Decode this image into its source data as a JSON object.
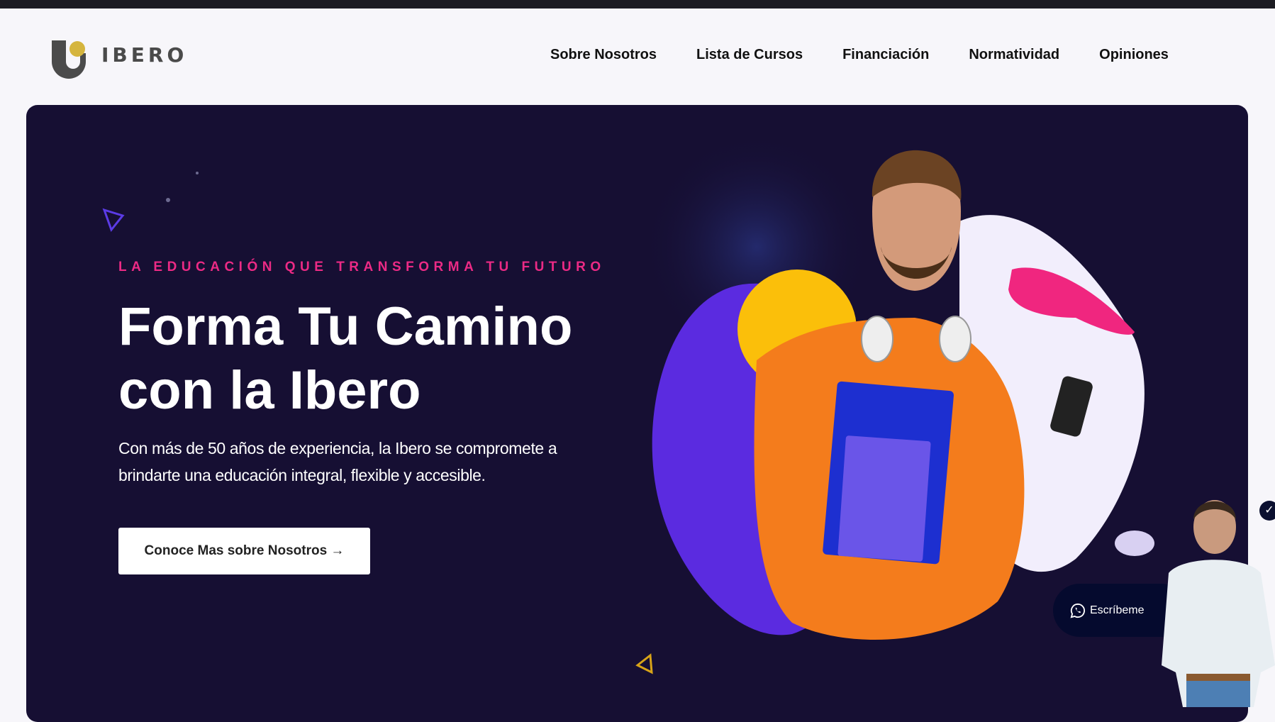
{
  "brand": {
    "name": "IBERO"
  },
  "nav": {
    "items": [
      {
        "label": "Sobre Nosotros"
      },
      {
        "label": "Lista de Cursos"
      },
      {
        "label": "Financiación"
      },
      {
        "label": "Normatividad"
      },
      {
        "label": "Opiniones"
      }
    ]
  },
  "hero": {
    "tagline": "LA EDUCACIÓN QUE TRANSFORMA TU FUTURO",
    "title_line1": "Forma Tu Camino",
    "title_line2": "con la Ibero",
    "description": "Con más de 50 años de experiencia, la Ibero se compromete a brindarte una educación integral, flexible y accesible.",
    "cta_label": "Conoce Mas sobre Nosotros →"
  },
  "chat": {
    "label": "Escríbeme",
    "icon": "whatsapp-icon"
  },
  "colors": {
    "hero_bg": "#160f33",
    "accent_pink": "#ec2a85",
    "purple": "#5b2be0",
    "yellow": "#fbbf0a"
  }
}
